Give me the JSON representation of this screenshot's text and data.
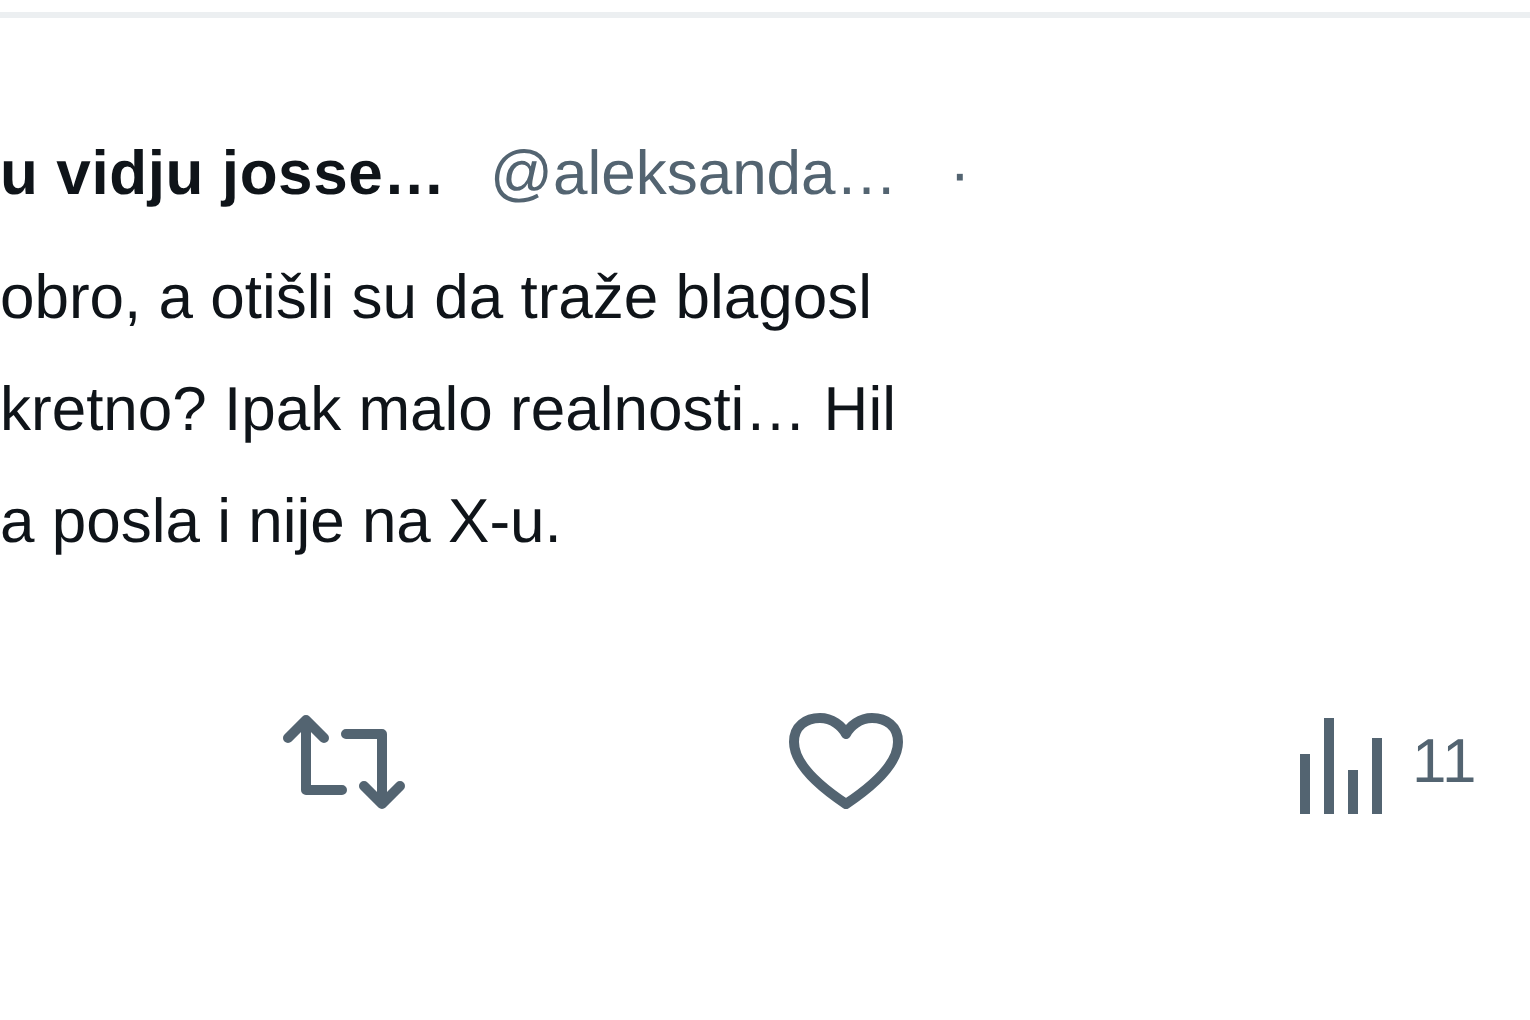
{
  "author": {
    "name": "u vidju josse…",
    "handle": "@aleksanda…",
    "separator": "·"
  },
  "body_lines": [
    "obro, a otišli su da traže blagosl",
    "kretno? Ipak malo realnosti… Hil",
    "a posla i nije na X-u."
  ],
  "actions": [
    {
      "kind": "repost"
    },
    {
      "kind": "like"
    },
    {
      "kind": "views",
      "count": "11"
    }
  ]
}
